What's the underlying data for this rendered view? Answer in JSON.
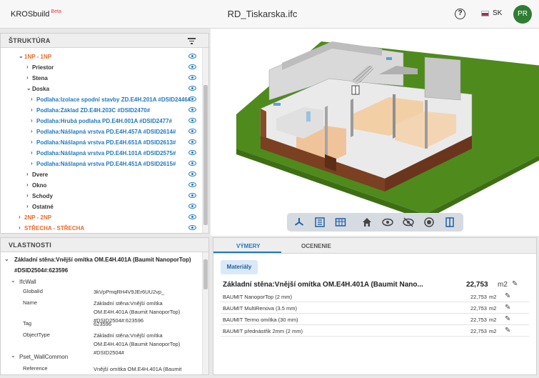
{
  "header": {
    "brand": "KROSbuild",
    "brand_badge": "Beta",
    "file_title": "RD_Tiskarska.ifc",
    "help_symbol": "?",
    "language": "SK",
    "user_initials": "PR"
  },
  "structure": {
    "title": "ŠTRUKTÚRA",
    "items": [
      {
        "label": "1NP - 1NP",
        "chevron": "⌄",
        "color": "orange"
      },
      {
        "label": "Priestor",
        "chevron": "›",
        "color": "dark"
      },
      {
        "label": "Stena",
        "chevron": "›",
        "color": "dark"
      },
      {
        "label": "Doska",
        "chevron": "⌄",
        "color": "dark"
      },
      {
        "label": "Podlaha:Izolace spodní stavby ZD.E4H.201A #DSID2446#",
        "chevron": "›",
        "color": "blue"
      },
      {
        "label": "Podlaha:Základ ZD.E4H.203C #DSID2470#",
        "chevron": "›",
        "color": "blue"
      },
      {
        "label": "Podlaha:Hrubá podlaha PD.E4H.001A #DSID2477#",
        "chevron": "›",
        "color": "blue"
      },
      {
        "label": "Podlaha:Nášlapná vrstva PD.E4H.457A #DSID2614#",
        "chevron": "›",
        "color": "blue"
      },
      {
        "label": "Podlaha:Nášlapná vrstva PD.E4H.651A #DSID2613#",
        "chevron": "›",
        "color": "blue"
      },
      {
        "label": "Podlaha:Nášlapná vrstva PD.E4H.101A #DSID2575#",
        "chevron": "›",
        "color": "blue"
      },
      {
        "label": "Podlaha:Nášlapná vrstva PD.E4H.451A #DSID2615#",
        "chevron": "›",
        "color": "blue"
      },
      {
        "label": "Dvere",
        "chevron": "›",
        "color": "dark"
      },
      {
        "label": "Okno",
        "chevron": "›",
        "color": "dark"
      },
      {
        "label": "Schody",
        "chevron": "›",
        "color": "dark"
      },
      {
        "label": "Ostatné",
        "chevron": "›",
        "color": "dark"
      },
      {
        "label": "2NP - 2NP",
        "chevron": "›",
        "color": "orange"
      },
      {
        "label": "STŘECHA - STŘECHA",
        "chevron": "›",
        "color": "orange"
      }
    ]
  },
  "properties": {
    "title": "VLASTNOSTI",
    "element_name_line1": "Základní stěna:Vnější omítka OM.E4H.401A (Baumit NanoporTop)",
    "element_name_line2": "#DSID2504#:623596",
    "group1": "IfcWall",
    "group2": "Pset_WallCommon",
    "rows": [
      {
        "key": "GlobalId",
        "value": "3kVpPmqRH4V9JEr6UU2vp_"
      },
      {
        "key": "Name",
        "value": "Základní stěna:Vnější omítka OM.E4H.401A (Baumit NanoporTop) #DSID2504#:623596"
      },
      {
        "key": "Tag",
        "value": "623596"
      },
      {
        "key": "ObjectType",
        "value": "Základní stěna:Vnější omítka OM.E4H.401A (Baumit NanoporTop) #DSID2504#"
      },
      {
        "key": "Reference",
        "value": "Vnější omítka OM.E4H.401A (Baumit"
      }
    ]
  },
  "measurements": {
    "tabs": [
      "VÝMERY",
      "OCENENIE"
    ],
    "materials_button": "Materiály",
    "summary": {
      "name": "Základní stěna:Vnější omítka OM.E4H.401A (Baumit Nano...",
      "value": "22,753",
      "unit": "m2"
    },
    "rows": [
      {
        "name": "BAUMIT NanoporTop (2 mm)",
        "value": "22,753",
        "unit": "m2"
      },
      {
        "name": "BAUMIT MultiRenova (3.5 mm)",
        "value": "22,753",
        "unit": "m2"
      },
      {
        "name": "BAUMIT Termo omítka (30 mm)",
        "value": "22,753",
        "unit": "m2"
      },
      {
        "name": "BAUMIT přednástřik 2mm (2 mm)",
        "value": "22,753",
        "unit": "m2"
      }
    ]
  },
  "colors": {
    "accent": "#1e78c2",
    "level": "#e8692a",
    "avatar": "#2e7d32"
  },
  "icons": {
    "toolbar": [
      "axes-icon",
      "list-icon",
      "table-icon",
      "home-icon",
      "eye-icon",
      "eye-off-icon",
      "record-icon",
      "section-icon"
    ]
  }
}
